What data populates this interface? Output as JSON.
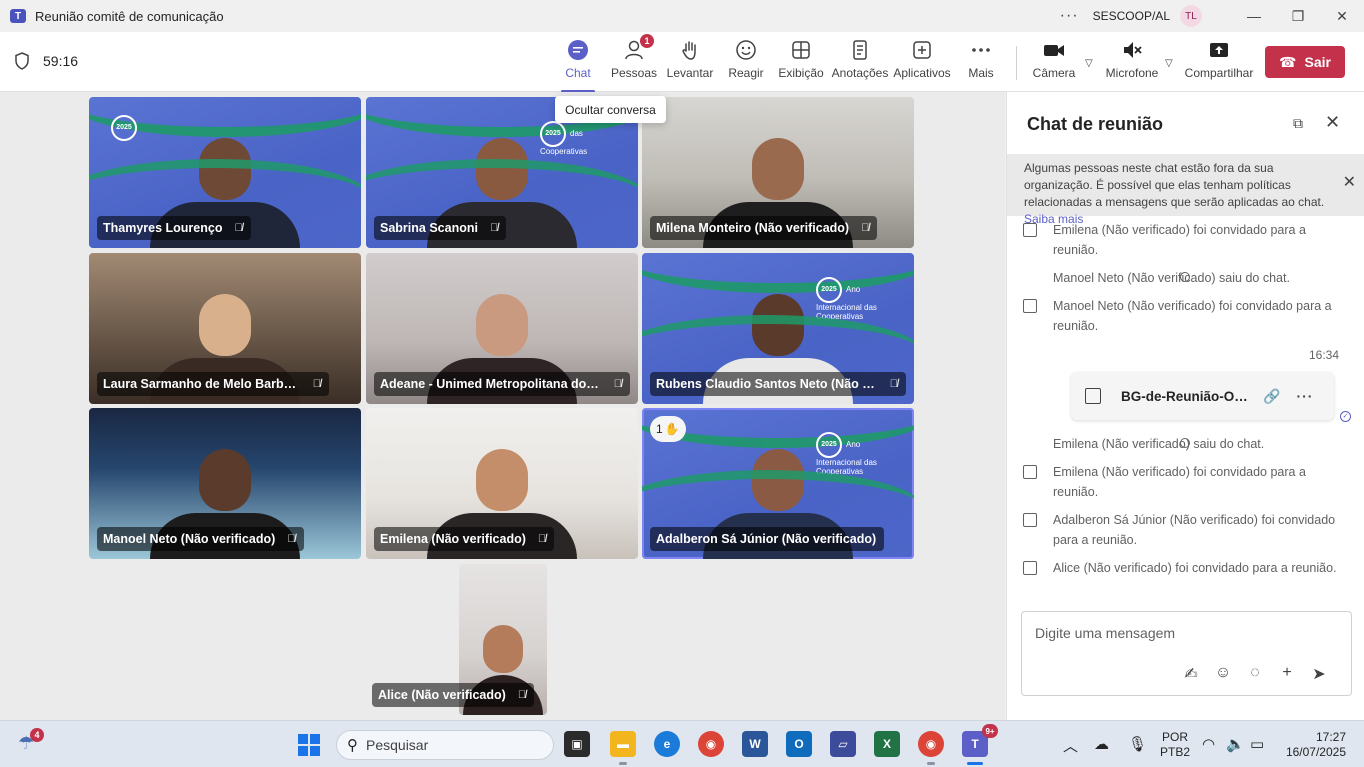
{
  "window": {
    "title": "Reunião comitê de comunicação",
    "org": "SESCOOP/AL",
    "avatar_initials": "TL"
  },
  "toolbar": {
    "timer": "59:16",
    "items": [
      {
        "label": "Chat",
        "icon": "chat-icon",
        "active": true
      },
      {
        "label": "Pessoas",
        "icon": "people-icon",
        "badge": "1"
      },
      {
        "label": "Levantar",
        "icon": "raise-hand-icon"
      },
      {
        "label": "Reagir",
        "icon": "emoji-icon"
      },
      {
        "label": "Exibição",
        "icon": "view-icon"
      },
      {
        "label": "Anotações",
        "icon": "notes-icon"
      },
      {
        "label": "Aplicativos",
        "icon": "apps-icon"
      },
      {
        "label": "Mais",
        "icon": "more-icon"
      }
    ],
    "camera": "Câmera",
    "mic": "Microfone",
    "share": "Compartilhar",
    "leave": "Sair",
    "tooltip": "Ocultar conversa",
    "accent": "#5b5fc7",
    "leave_color": "#c4314b"
  },
  "participants": [
    {
      "name": "Thamyres Lourenço",
      "muted": true
    },
    {
      "name": "Sabrina Scanoni",
      "muted": true
    },
    {
      "name": "Milena Monteiro (Não verificado)",
      "muted": true
    },
    {
      "name": "Laura Sarmanho de Melo Barbosa (Externo)",
      "muted": true
    },
    {
      "name": "Adeane - Unimed Metropolitana do Agreste",
      "muted": true
    },
    {
      "name": "Rubens Claudio Santos Neto (Não verificado)",
      "muted": true
    },
    {
      "name": "Manoel Neto (Não verificado)",
      "muted": true
    },
    {
      "name": "Emilena (Não verificado)",
      "muted": true
    },
    {
      "name": "Adalberon Sá Júnior (Não verificado)",
      "muted": false,
      "hand_raised": "1"
    },
    {
      "name": "Alice (Não verificado)",
      "muted": true
    }
  ],
  "chat": {
    "title": "Chat de reunião",
    "notice": "Algumas pessoas neste chat estão fora da sua organização. É possível que elas tenham políticas relacionadas a mensagens que serão aplicadas ao chat.",
    "notice_link": "Saiba mais",
    "events_before": [
      "Emilena (Não verificado) foi convidado para a reunião.",
      "Manoel Neto (Não verificado) saiu do chat.",
      "Manoel Neto (Não verificado) foi convidado para a reunião."
    ],
    "timestamp": "16:34",
    "file_name": "BG-de-Reunião-Online",
    "events_after": [
      "Emilena (Não verificado) saiu do chat.",
      "Emilena (Não verificado) foi convidado para a reunião.",
      "Adalberon Sá Júnior (Não verificado) foi convidado para a reunião.",
      "Alice (Não verificado) foi convidado para a reunião."
    ],
    "compose_placeholder": "Digite uma mensagem"
  },
  "taskbar": {
    "weather_badge": "4",
    "search_placeholder": "Pesquisar",
    "teams_badge": "9+",
    "lang_line1": "POR",
    "lang_line2": "PTB2",
    "time": "17:27",
    "date": "16/07/2025"
  }
}
